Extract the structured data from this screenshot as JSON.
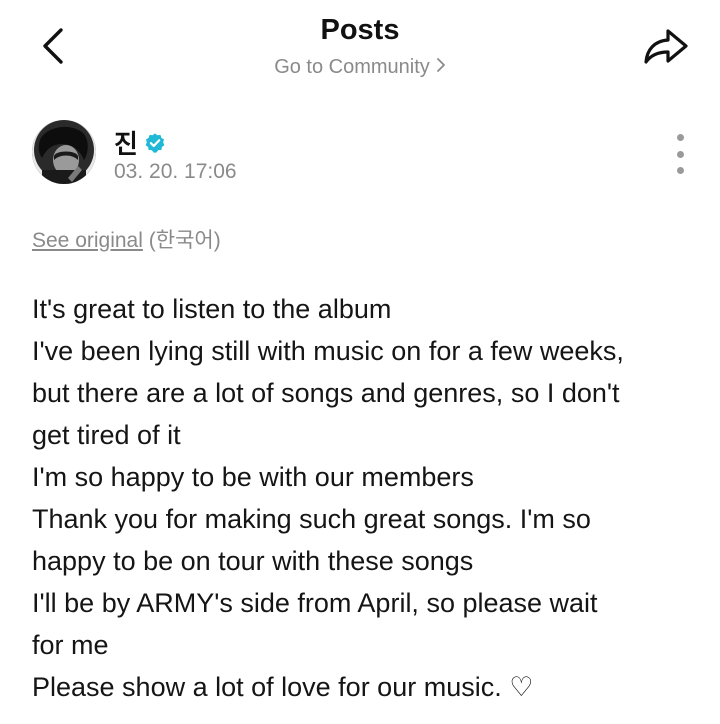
{
  "header": {
    "title": "Posts",
    "subtitle": "Go to Community"
  },
  "icons": {
    "back": "chevron-left-icon",
    "share": "share-arrow-icon",
    "more": "more-vertical-icon",
    "verified": "verified-badge-icon"
  },
  "colors": {
    "verified_badge": "#1fb8d6",
    "muted_text": "#8a8a8a"
  },
  "post": {
    "author": "진",
    "timestamp": "03. 20. 17:06",
    "see_original": "See original",
    "language": "(한국어)",
    "lines": [
      "It's great to listen to the album",
      "I've been lying still with music on for a few weeks,",
      "but there are a lot of songs and genres, so I don't",
      "get tired of it",
      "I'm so happy to be with our members",
      "Thank you for making such great songs. I'm so",
      "happy to be on tour with these songs",
      "I'll be by ARMY's side from April, so please wait",
      "for me",
      "Please show a lot of love for our music. ♡"
    ]
  }
}
